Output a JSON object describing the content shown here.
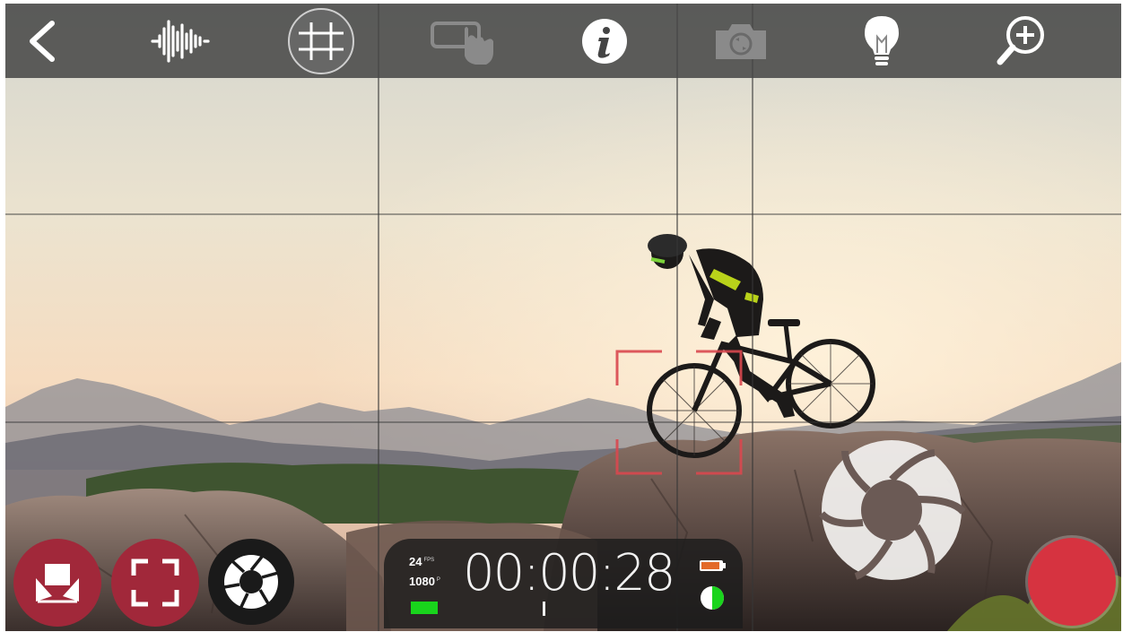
{
  "camera_view": {
    "title": "Camera viewfinder",
    "grid_overlay": true
  },
  "toolbar": {
    "items": [
      {
        "name": "back-icon",
        "label": "Back"
      },
      {
        "name": "audio-waveform-icon",
        "label": "Audio"
      },
      {
        "name": "grid-overlay-icon",
        "label": "Grid"
      },
      {
        "name": "touch-gesture-icon",
        "label": "Gestures"
      },
      {
        "name": "info-icon",
        "label": "Info"
      },
      {
        "name": "camera-switch-icon",
        "label": "Switch camera"
      },
      {
        "name": "light-bulb-icon",
        "label": "Light"
      },
      {
        "name": "zoom-in-icon",
        "label": "Zoom"
      }
    ]
  },
  "status": {
    "fps_value": "24",
    "fps_unit": "FPS",
    "resolution_value": "1080",
    "resolution_unit": "P",
    "timecode": "00:00:28"
  },
  "colors": {
    "record": "#d63340",
    "control_red": "#a1283a",
    "storage_green": "#19d41c",
    "battery_orange": "#e36a2a",
    "focus_box": "#d9484f"
  },
  "controls": {
    "left_buttons": [
      "focus-lock-icon",
      "frame-expand-icon",
      "aperture-icon"
    ],
    "right_buttons": [
      "shutter-aperture-icon",
      "record-button"
    ]
  }
}
